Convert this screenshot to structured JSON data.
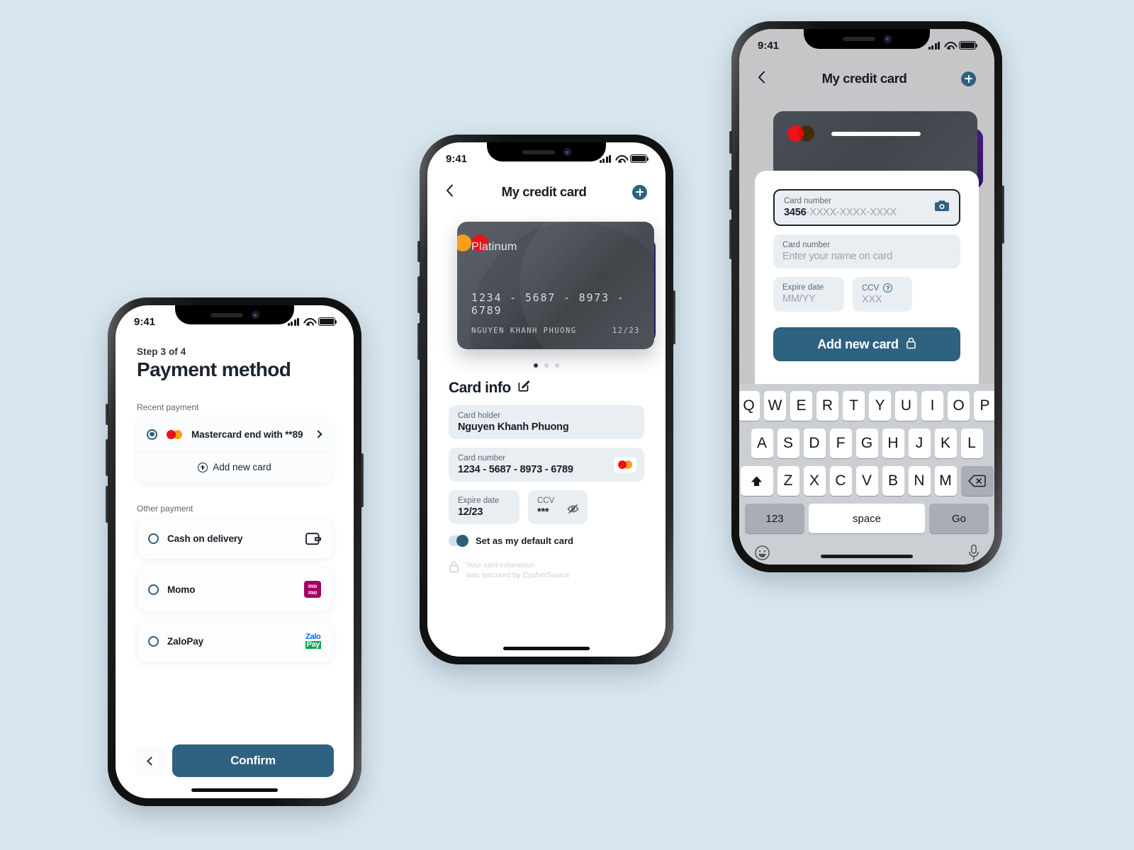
{
  "canvas": {
    "background": "#d7e5ee"
  },
  "theme": {
    "accent": "#2f6180",
    "accent_dark": "#2d6078",
    "mastercard_red": "#e8141b",
    "mastercard_orange": "#f79e1b",
    "momo_pink": "#a50064",
    "zalo_blue": "#0068ff",
    "zalo_green": "#01a94e",
    "card_purple": "#4b1f86"
  },
  "phone1": {
    "status": {
      "time": "9:41"
    },
    "step": "Step 3 of 4",
    "title": "Payment method",
    "recent_label": "Recent payment",
    "recent": {
      "name": "Mastercard end with **89",
      "selected": true,
      "logo": "mastercard-logo"
    },
    "add_new_card": "Add new card",
    "other_label": "Other payment",
    "other_methods": [
      {
        "name": "Cash on delivery",
        "logo": "wallet-icon",
        "selected": false
      },
      {
        "name": "Momo",
        "logo": "momo-logo",
        "logo_text_top": "mo",
        "logo_text_bottom": "mo",
        "selected": false
      },
      {
        "name": "ZaloPay",
        "logo": "zalopay-logo",
        "logo_text_top": "Zalo",
        "logo_text_bottom": "Pay",
        "selected": false
      }
    ],
    "footer": {
      "back": "back-chevron",
      "confirm": "Confirm"
    }
  },
  "phone2": {
    "status": {
      "time": "9:41"
    },
    "nav": {
      "back": "back-chevron",
      "title": "My credit card",
      "add": "plus-icon"
    },
    "credit_card": {
      "brand": "Platinum",
      "number": "1234 - 5687 - 8973 - 6789",
      "holder": "NGUYEN KHANH PHUONG",
      "expiry": "12/23",
      "logo": "mastercard-logo"
    },
    "carousel": {
      "count": 3,
      "active": 0
    },
    "section_title": "Card info",
    "edit_icon": "edit-icon",
    "fields": {
      "holder_label": "Card holder",
      "holder_value": "Nguyen Khanh Phuong",
      "number_label": "Card number",
      "number_value": "1234 - 5687 - 8973 - 6789",
      "expire_label": "Expire date",
      "expire_value": "12/23",
      "ccv_label": "CCV",
      "ccv_value": "***"
    },
    "default_toggle": {
      "label": "Set as my default card",
      "on": true
    },
    "secure_note_line1": "Your card infomation",
    "secure_note_line2": "was sercured by CypherSource"
  },
  "phone3": {
    "status": {
      "time": "9:41"
    },
    "nav": {
      "back": "back-chevron",
      "title": "My credit card",
      "add": "plus-icon"
    },
    "form": {
      "card_number_label": "Card number",
      "card_number_prefix": "3456",
      "card_number_rest": "-XXXX-XXXX-XXXX",
      "card_number_focused": true,
      "name_label": "Card number",
      "name_placeholder": "Enter your name on card",
      "expire_label": "Expire date",
      "expire_placeholder": "MM/YY",
      "ccv_label": "CCV",
      "ccv_placeholder": "XXX",
      "ccv_help": "?",
      "camera_icon": "camera-icon",
      "submit": "Add new card",
      "submit_icon": "lock-icon"
    },
    "keyboard": {
      "row1": [
        "Q",
        "W",
        "E",
        "R",
        "T",
        "Y",
        "U",
        "I",
        "O",
        "P"
      ],
      "row2": [
        "A",
        "S",
        "D",
        "F",
        "G",
        "H",
        "J",
        "K",
        "L"
      ],
      "row3": [
        "Z",
        "X",
        "C",
        "V",
        "B",
        "N",
        "M"
      ],
      "shift": "shift-icon",
      "backspace": "backspace-icon",
      "numbers": "123",
      "space": "space",
      "go": "Go",
      "emoji": "emoji-icon",
      "mic": "microphone-icon"
    }
  }
}
